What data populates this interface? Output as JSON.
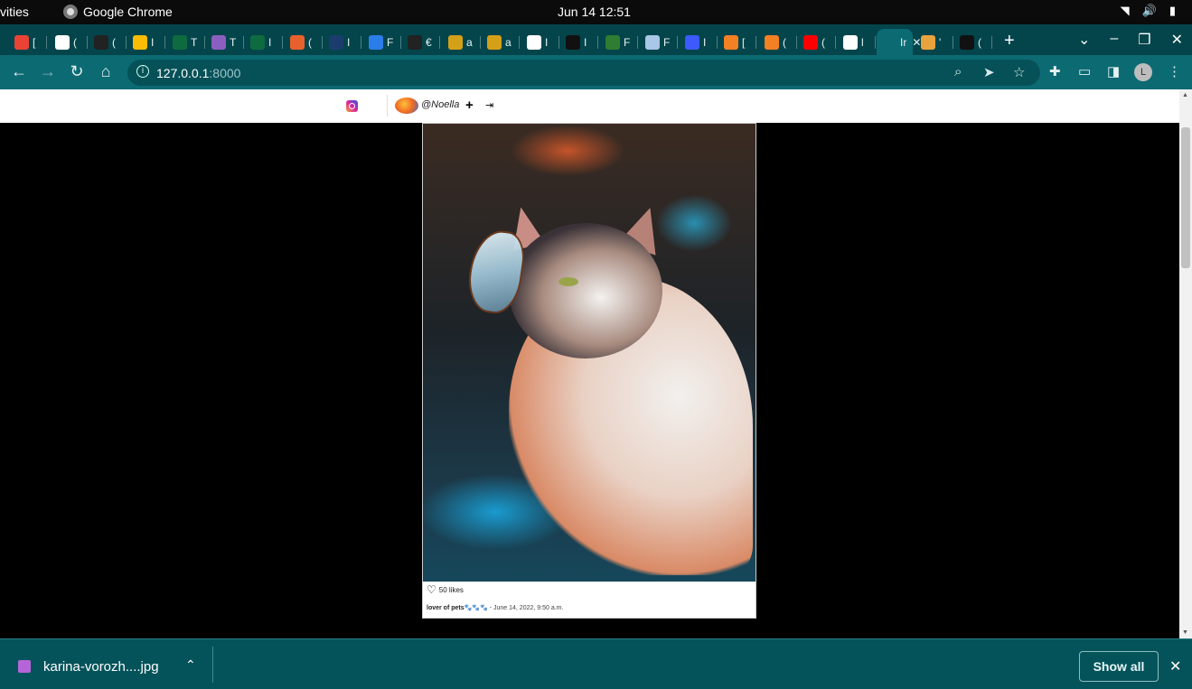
{
  "os": {
    "activities": "vities",
    "app_name": "Google Chrome",
    "clock": "Jun 14  12:51"
  },
  "tabs": [
    {
      "label": "[",
      "color": "#ea4335",
      "favicon": "gmail-icon"
    },
    {
      "label": "(",
      "color": "#ffffff",
      "favicon": "globe-icon"
    },
    {
      "label": "(",
      "color": "#222222",
      "favicon": "github-icon"
    },
    {
      "label": "I",
      "color": "#fbbc04",
      "favicon": "drive-icon"
    },
    {
      "label": "T",
      "color": "#0e6b40",
      "favicon": "tree-icon"
    },
    {
      "label": "T",
      "color": "#8b5fbf",
      "favicon": "h-icon"
    },
    {
      "label": "I",
      "color": "#0e6b40",
      "favicon": "tree-icon"
    },
    {
      "label": "(",
      "color": "#e8612c",
      "favicon": "ask-icon"
    },
    {
      "label": "I",
      "color": "#1b3d6d",
      "favicon": "chart-icon"
    },
    {
      "label": "F",
      "color": "#2b7de9",
      "favicon": "loop-icon"
    },
    {
      "label": "€",
      "color": "#222222",
      "favicon": "github-icon"
    },
    {
      "label": "a",
      "color": "#d4a017",
      "favicon": "trophy-icon"
    },
    {
      "label": "a",
      "color": "#d4a017",
      "favicon": "trophy-icon"
    },
    {
      "label": "I",
      "color": "#ffffff",
      "favicon": "google-icon"
    },
    {
      "label": "I",
      "color": "#111111",
      "favicon": "dev-icon"
    },
    {
      "label": "F",
      "color": "#2e7d32",
      "favicon": "shield-icon"
    },
    {
      "label": "F",
      "color": "#a9c7e6",
      "favicon": "postgres-icon"
    },
    {
      "label": "I",
      "color": "#3d5afe",
      "favicon": "a-icon"
    },
    {
      "label": "[",
      "color": "#f48024",
      "favicon": "stackoverflow-icon"
    },
    {
      "label": "(",
      "color": "#f48024",
      "favicon": "stackoverflow-icon"
    },
    {
      "label": "(",
      "color": "#ff0000",
      "favicon": "youtube-icon"
    },
    {
      "label": "l",
      "color": "#ffffff",
      "favicon": "globe-icon"
    },
    {
      "label": "Ir",
      "color": "#0c6a73",
      "favicon": "active-tab-icon"
    },
    {
      "label": "'",
      "color": "#e8a33d",
      "favicon": "shield-icon"
    },
    {
      "label": "(",
      "color": "#111111",
      "favicon": "unsplash-icon"
    }
  ],
  "browser": {
    "url_host": "127.0.0.1",
    "url_port": ":8000",
    "profile_initial": "L"
  },
  "site": {
    "username": "@Noella",
    "add_label": "+",
    "logout_label": "⇥"
  },
  "post": {
    "likes": "50 likes",
    "caption_title": "lover of pets",
    "caption_emoji": "🐾🐾🐾",
    "date": " - June 14, 2022, 9:50 a.m."
  },
  "downloads": {
    "filename": "karina-vorozh....jpg",
    "show_all": "Show all"
  },
  "colors": {
    "tab_strip": "#03454b",
    "toolbar": "#0c6a73",
    "download_bar": "#05535a"
  }
}
